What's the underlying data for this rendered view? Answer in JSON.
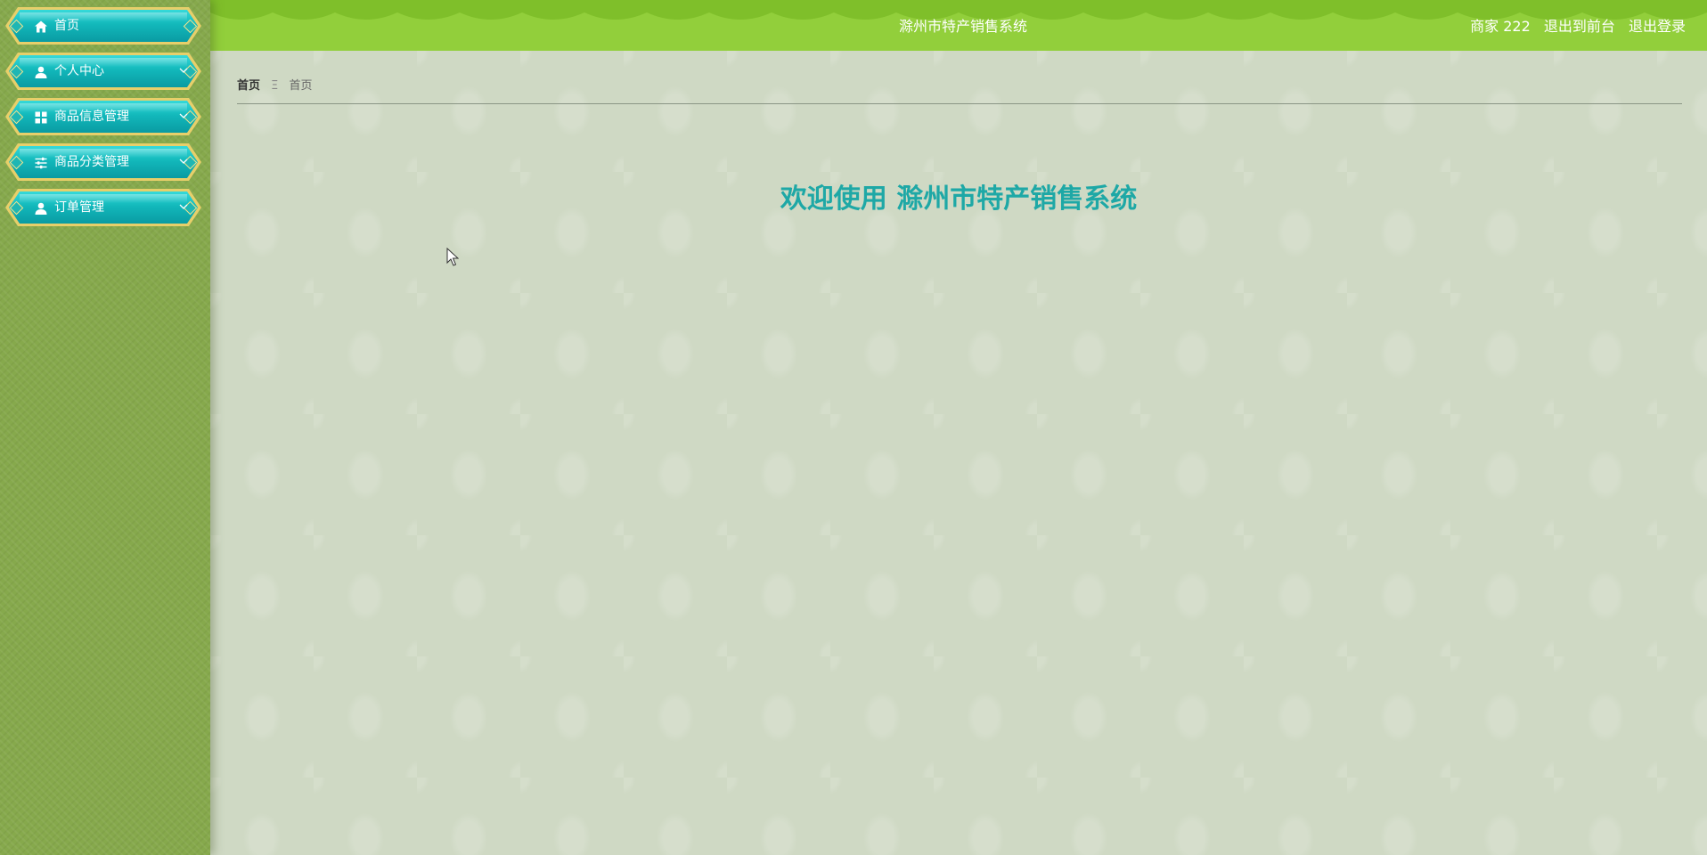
{
  "header": {
    "title": "滁州市特产销售系统",
    "user": "商家 222",
    "to_front": "退出到前台",
    "logout": "退出登录",
    "bg_color": "#92cf3b"
  },
  "sidebar": {
    "items": [
      {
        "label": "首页",
        "icon": "home-icon",
        "has_submenu": false
      },
      {
        "label": "个人中心",
        "icon": "user-icon",
        "has_submenu": true
      },
      {
        "label": "商品信息管理",
        "icon": "grid-icon",
        "has_submenu": true
      },
      {
        "label": "商品分类管理",
        "icon": "sliders-icon",
        "has_submenu": true
      },
      {
        "label": "订单管理",
        "icon": "user-icon",
        "has_submenu": true
      }
    ]
  },
  "breadcrumb": {
    "home": "首页",
    "separator": "Ξ",
    "current": "首页"
  },
  "main": {
    "welcome": "欢迎使用 滁州市特产销售系统"
  },
  "colors": {
    "accent": "#1ea8a6",
    "menu_teal": "#12b8bb",
    "menu_border": "#e7cf6a",
    "sidebar_bg": "#86a94c",
    "content_bg": "#cfd9c4"
  }
}
